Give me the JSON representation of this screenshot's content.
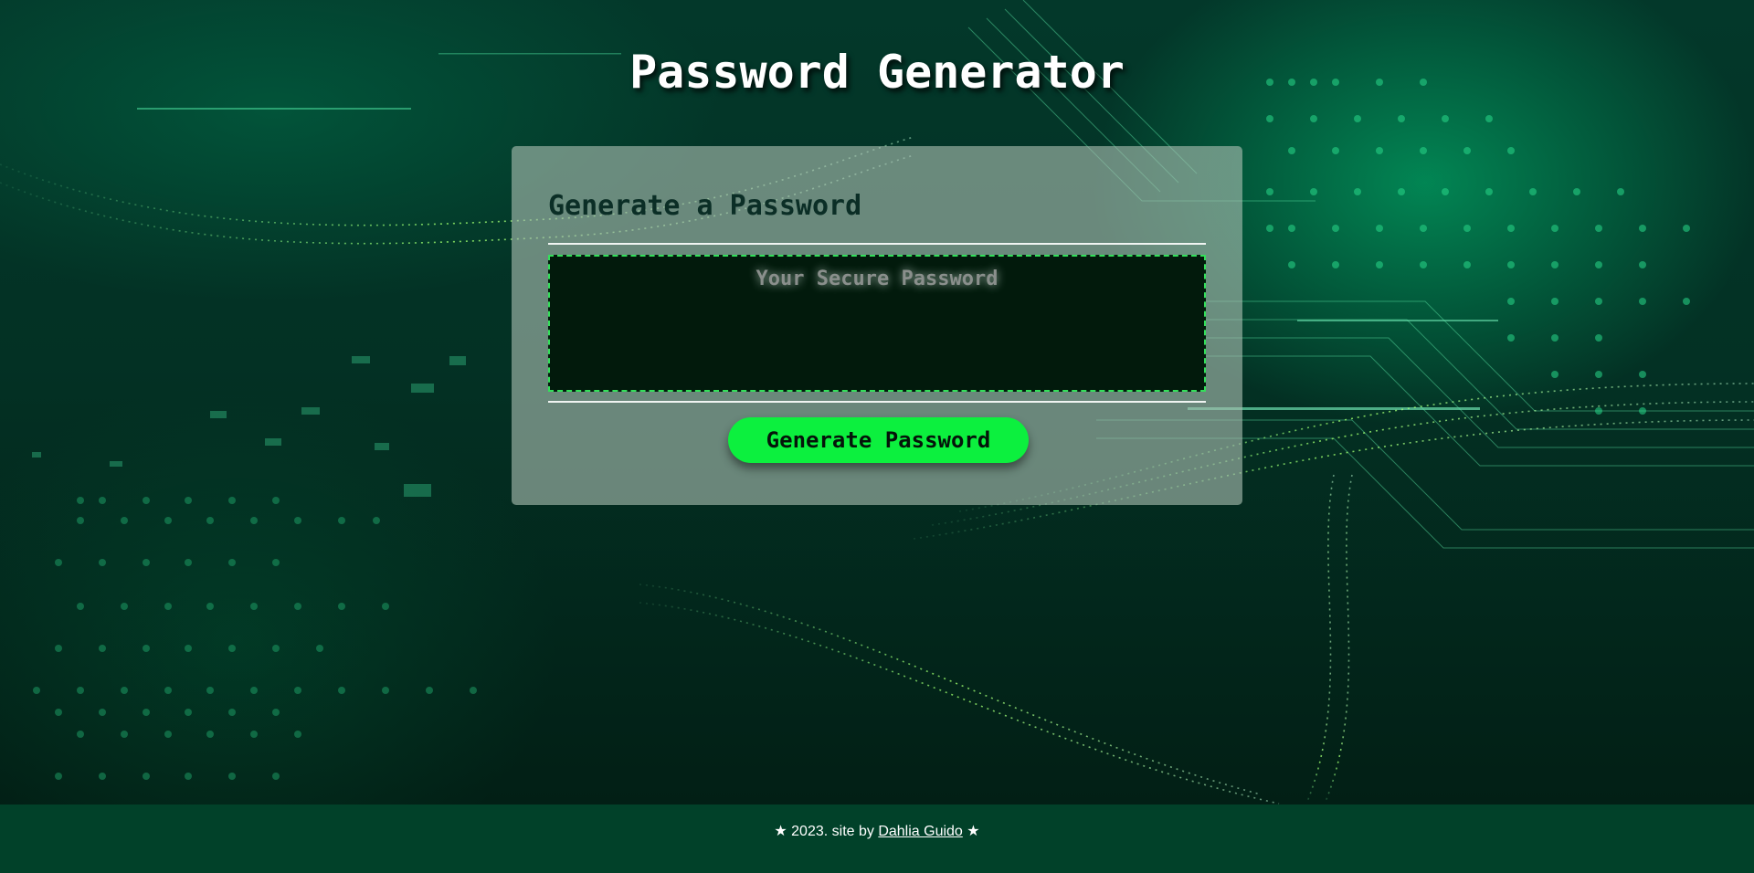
{
  "page": {
    "title": "Password Generator"
  },
  "card": {
    "heading": "Generate a Password",
    "password_placeholder": "Your Secure Password",
    "password_value": "",
    "generate_button_label": "Generate Password"
  },
  "footer": {
    "prefix": "★ 2023. site by ",
    "author_link": "Dahlia Guido",
    "suffix": " ★"
  },
  "colors": {
    "accent_button": "#0cf03e",
    "password_border": "#33e05a",
    "footer_bg": "#014129",
    "background": "#033124"
  }
}
